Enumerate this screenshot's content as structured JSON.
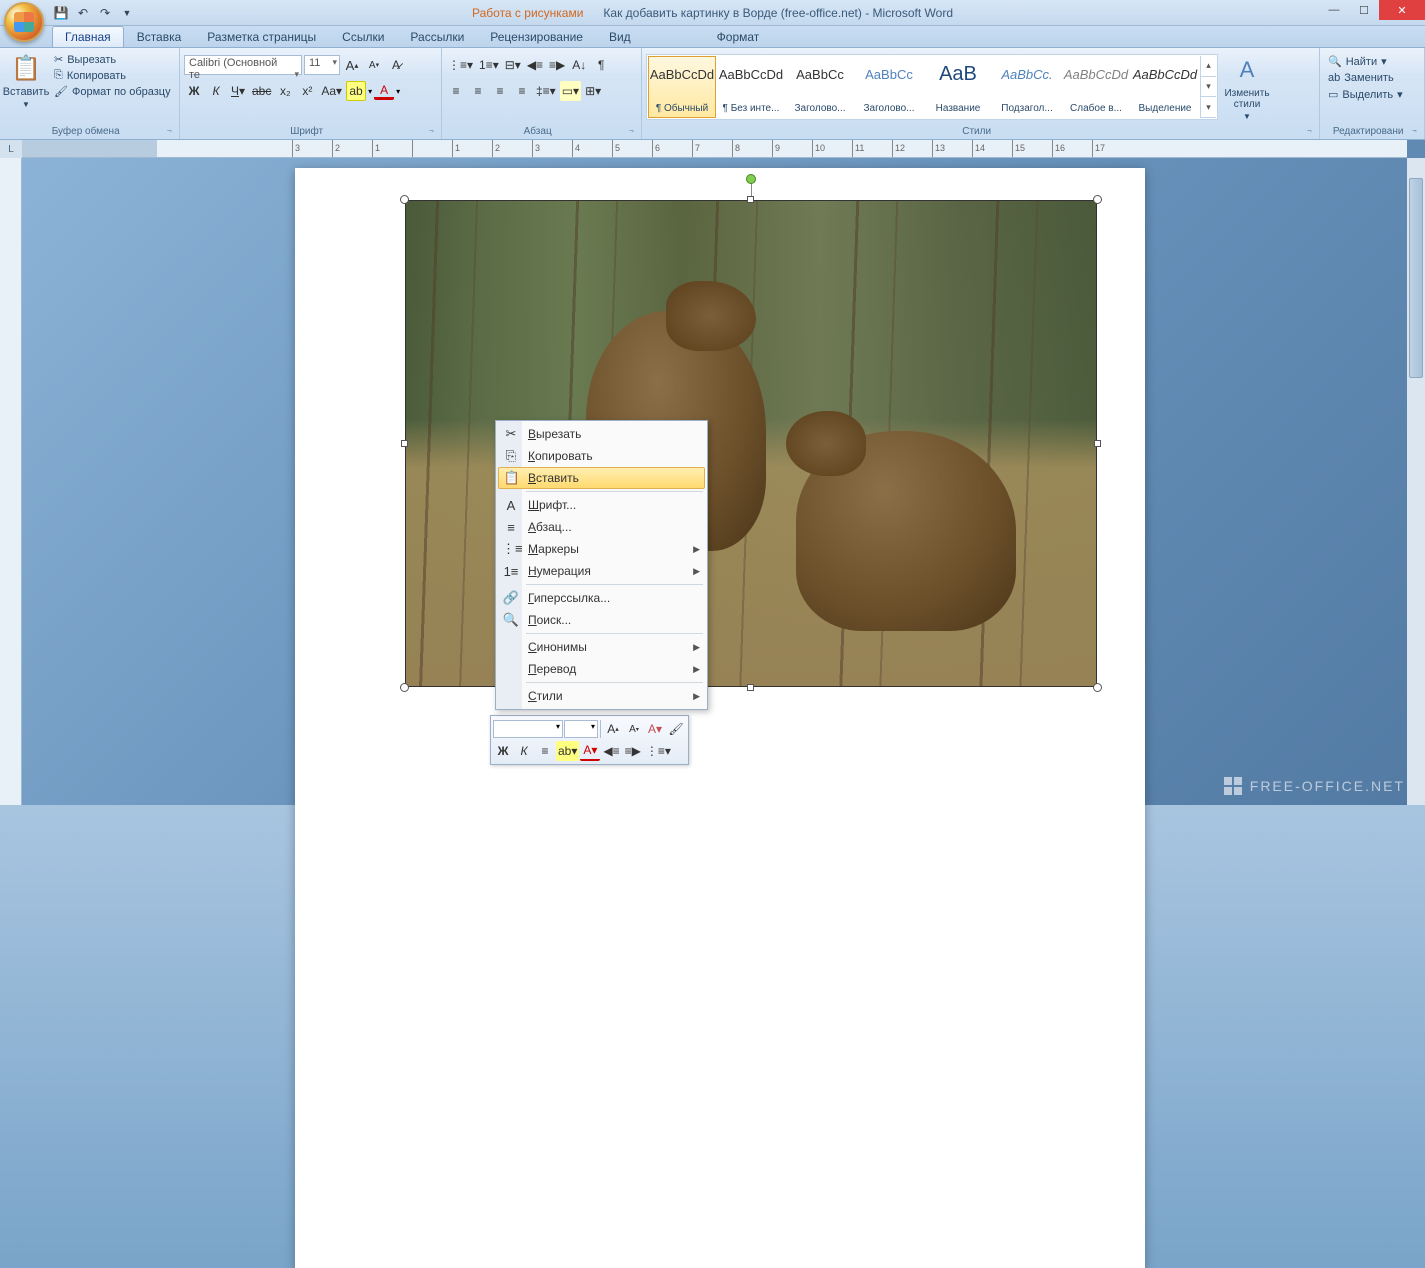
{
  "titlebar": {
    "context_tab": "Работа с рисунками",
    "document_title": "Как добавить картинку в Ворде (free-office.net) - Microsoft Word"
  },
  "tabs": [
    "Главная",
    "Вставка",
    "Разметка страницы",
    "Ссылки",
    "Рассылки",
    "Рецензирование",
    "Вид"
  ],
  "context_tabs": [
    "Формат"
  ],
  "active_tab": "Главная",
  "ribbon": {
    "clipboard": {
      "paste": "Вставить",
      "cut": "Вырезать",
      "copy": "Копировать",
      "format_painter": "Формат по образцу",
      "group_label": "Буфер обмена"
    },
    "font": {
      "font_name": "Calibri (Основной те",
      "font_size": "11",
      "group_label": "Шрифт"
    },
    "paragraph": {
      "group_label": "Абзац"
    },
    "styles": {
      "items": [
        {
          "preview": "AaBbCcDd",
          "name": "¶ Обычный",
          "selected": true
        },
        {
          "preview": "AaBbCcDd",
          "name": "¶ Без инте..."
        },
        {
          "preview": "AaBbCc",
          "name": "Заголово..."
        },
        {
          "preview": "AaBbCc",
          "name": "Заголово...",
          "color": "#4f81bd"
        },
        {
          "preview": "AaB",
          "name": "Название",
          "color": "#1f497d",
          "big": true
        },
        {
          "preview": "AaBbCc.",
          "name": "Подзагол...",
          "color": "#4f81bd",
          "italic": true
        },
        {
          "preview": "AaBbCcDd",
          "name": "Слабое в...",
          "color": "#808080",
          "italic": true
        },
        {
          "preview": "AaBbCcDd",
          "name": "Выделение",
          "italic": true
        }
      ],
      "change_styles": "Изменить стили",
      "group_label": "Стили"
    },
    "editing": {
      "find": "Найти",
      "replace": "Заменить",
      "select": "Выделить",
      "group_label": "Редактировани"
    }
  },
  "ruler_h": [
    "3",
    "2",
    "1",
    "",
    "1",
    "2",
    "3",
    "4",
    "5",
    "6",
    "7",
    "8",
    "9",
    "10",
    "11",
    "12",
    "13",
    "14",
    "15",
    "16",
    "17"
  ],
  "context_menu": {
    "items": [
      {
        "icon": "✂",
        "label": "Вырезать",
        "u": 0
      },
      {
        "icon": "⎘",
        "label": "Копировать",
        "u": 0
      },
      {
        "icon": "📋",
        "label": "Вставить",
        "u": 0,
        "hover": true
      },
      {
        "sep": true
      },
      {
        "icon": "A",
        "label": "Шрифт...",
        "u": 0
      },
      {
        "icon": "≡",
        "label": "Абзац...",
        "u": 0
      },
      {
        "icon": "⋮≡",
        "label": "Маркеры",
        "u": 0,
        "arrow": true
      },
      {
        "icon": "1≡",
        "label": "Нумерация",
        "u": 0,
        "arrow": true
      },
      {
        "sep": true
      },
      {
        "icon": "🔗",
        "label": "Гиперссылка...",
        "u": 0
      },
      {
        "icon": "🔍",
        "label": "Поиск...",
        "u": 0
      },
      {
        "sep": true
      },
      {
        "label": "Синонимы",
        "u": 0,
        "arrow": true
      },
      {
        "label": "Перевод",
        "u": 0,
        "arrow": true
      },
      {
        "sep": true
      },
      {
        "label": "Стили",
        "u": 0,
        "arrow": true
      }
    ]
  },
  "watermark": "FREE-OFFICE.NET"
}
